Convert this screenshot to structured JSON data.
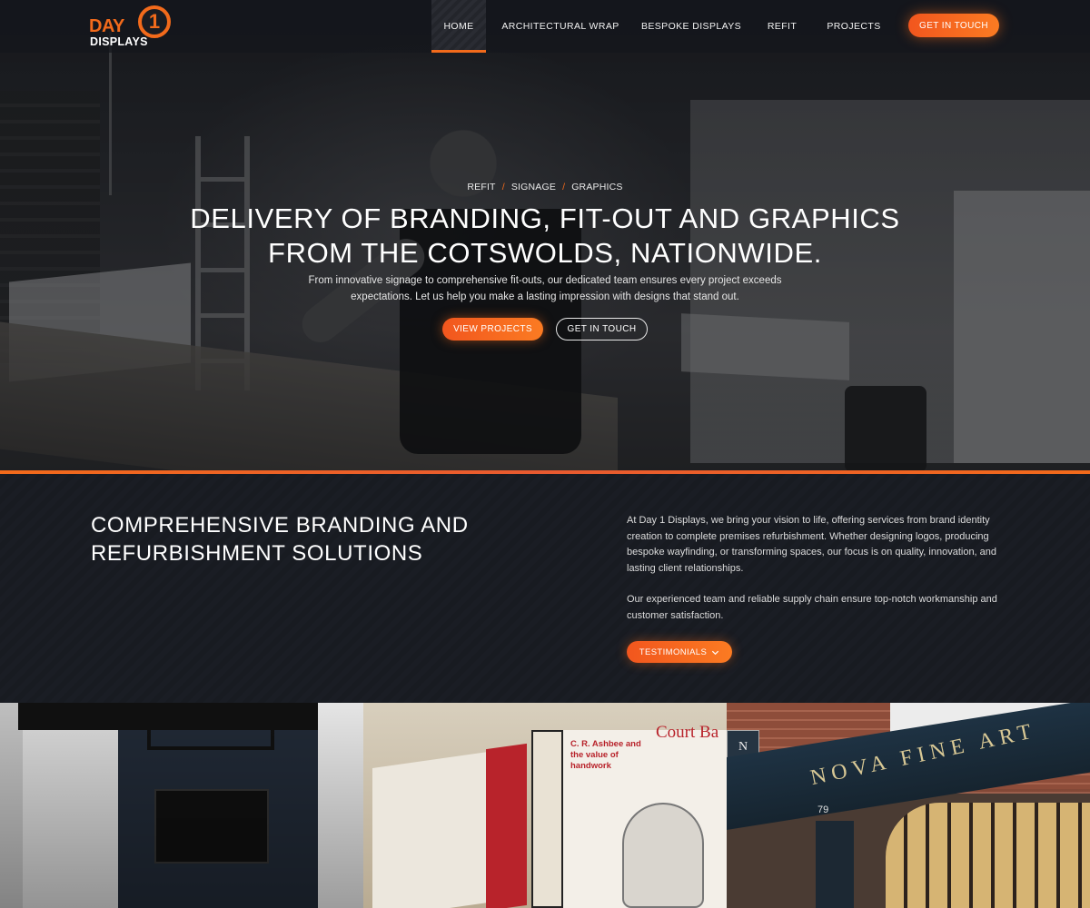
{
  "brand": {
    "line1": "DAY",
    "numeral": "1",
    "line2": "DISPLAYS",
    "accent": "#f26a1b"
  },
  "nav": {
    "items": [
      {
        "label": "HOME",
        "active": true
      },
      {
        "label": "ARCHITECTURAL WRAP",
        "active": false
      },
      {
        "label": "BESPOKE DISPLAYS",
        "active": false
      },
      {
        "label": "REFIT",
        "active": false
      },
      {
        "label": "PROJECTS",
        "active": false
      }
    ],
    "cta": "GET IN TOUCH"
  },
  "hero": {
    "breadcrumbs": [
      "REFIT",
      "SIGNAGE",
      "GRAPHICS"
    ],
    "separator": "/",
    "title_line1": "DELIVERY OF BRANDING, FIT-OUT AND GRAPHICS",
    "title_line2": "FROM THE COTSWOLDS, NATIONWIDE.",
    "subtitle": "From innovative signage to comprehensive fit-outs, our dedicated team ensures every project exceeds expectations. Let us help you make a lasting impression with designs that stand out.",
    "primary_button": "VIEW PROJECTS",
    "secondary_button": "GET IN TOUCH"
  },
  "intro": {
    "heading_line1": "COMPREHENSIVE BRANDING AND",
    "heading_line2": "REFURBISHMENT SOLUTIONS",
    "paragraph1": "At Day 1 Displays, we bring your vision to life, offering services from brand identity creation to complete premises refurbishment. Whether designing logos, producing bespoke wayfinding, or transforming spaces, our focus is on quality, innovation, and lasting client relationships.",
    "paragraph2": "Our experienced team and reliable supply chain ensure top-notch workmanship and customer satisfaction.",
    "testimonials_button": "TESTIMONIALS",
    "testimonials_icon": "chevron-down-icon"
  },
  "gallery": {
    "tile2_heading": "Court Ba",
    "tile2_panel": "C. R. Ashbee and the value of handwork",
    "tile3_sign": "NOVA FINE ART",
    "tile3_number": "79",
    "tile3_badge": "N"
  }
}
